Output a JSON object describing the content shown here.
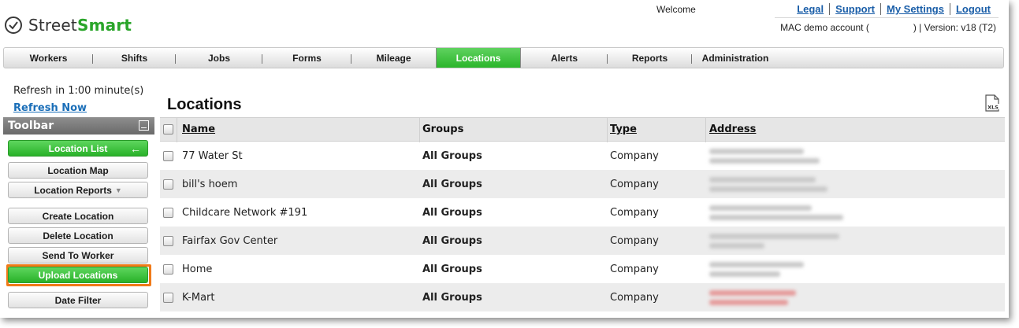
{
  "header": {
    "logo": {
      "brand_prefix": "Street",
      "brand_suffix": "Smart",
      "icon": "checkmark-circle-icon"
    },
    "welcome": "Welcome",
    "links": [
      "Legal",
      "Support",
      "My Settings",
      "Logout"
    ],
    "account_name": "MAC demo account (",
    "account_suffix": ")  |  Version: v18 (T2)"
  },
  "nav": {
    "items": [
      "Workers",
      "Shifts",
      "Jobs",
      "Forms",
      "Mileage",
      "Locations",
      "Alerts",
      "Reports",
      "Administration"
    ],
    "active": "Locations",
    "active_color": "#2bb52b"
  },
  "sidebar": {
    "refresh_text": "Refresh in 1:00 minute(s)",
    "refresh_link": "Refresh Now",
    "toolbar_title": "Toolbar",
    "buttons": {
      "location_list": "Location List",
      "location_map": "Location Map",
      "location_reports": "Location Reports",
      "create_location": "Create Location",
      "delete_location": "Delete Location",
      "send_to_worker": "Send To Worker",
      "upload_locations": "Upload Locations",
      "date_filter": "Date Filter"
    },
    "highlight_color": "#f07a18"
  },
  "main": {
    "title": "Locations",
    "export_icon": "xls-export-icon",
    "columns": [
      "Name",
      "Groups",
      "Type",
      "Address"
    ],
    "rows": [
      {
        "name": "77 Water St",
        "groups": "All Groups",
        "type": "Company"
      },
      {
        "name": "bill's hoem",
        "groups": "All Groups",
        "type": "Company"
      },
      {
        "name": "Childcare Network #191",
        "groups": "All Groups",
        "type": "Company"
      },
      {
        "name": "Fairfax Gov Center",
        "groups": "All Groups",
        "type": "Company"
      },
      {
        "name": "Home",
        "groups": "All Groups",
        "type": "Company"
      },
      {
        "name": "K-Mart",
        "groups": "All Groups",
        "type": "Company"
      }
    ]
  }
}
